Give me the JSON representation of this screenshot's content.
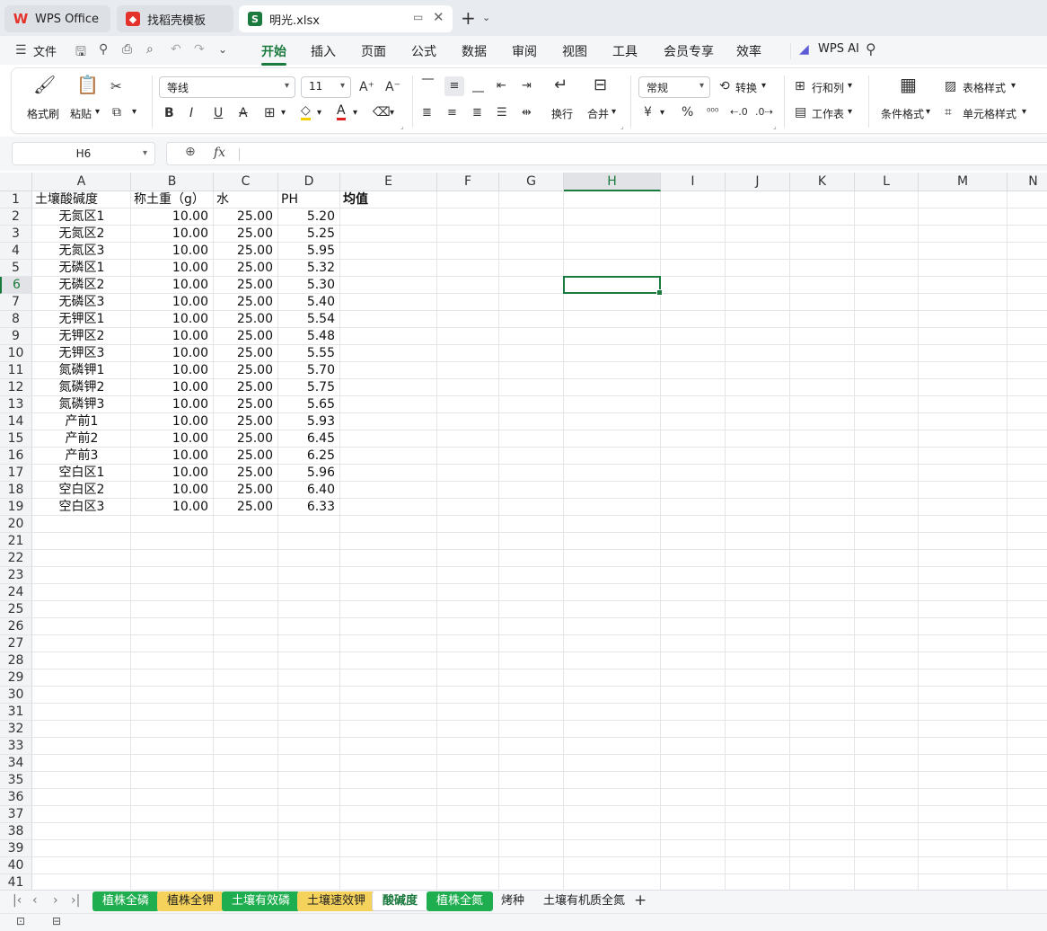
{
  "tabs": [
    {
      "label": "WPS Office",
      "icon": "wps-logo-icon",
      "color": "#e4322b"
    },
    {
      "label": "找稻壳模板",
      "icon": "docer-icon",
      "color": "#e4322b"
    },
    {
      "label": "明光.xlsx",
      "icon": "spreadsheet-icon",
      "color": "#1b7a3e"
    }
  ],
  "menu": {
    "file": "文件",
    "items": [
      "开始",
      "插入",
      "页面",
      "公式",
      "数据",
      "审阅",
      "视图",
      "工具",
      "会员专享",
      "效率"
    ],
    "active": "开始",
    "wps_ai": "WPS AI"
  },
  "ribbon": {
    "format_painter": "格式刷",
    "paste": "粘贴",
    "font_name": "等线",
    "font_size": "11",
    "wrap": "换行",
    "merge": "合并",
    "number_format": "常规",
    "convert": "转换",
    "row_col": "行和列",
    "worksheet": "工作表",
    "cond_format": "条件格式",
    "table_style": "表格样式",
    "cell_style": "单元格样式",
    "currency": "¥",
    "percent": "%"
  },
  "formula_bar": {
    "name_box": "H6",
    "fx": "fx",
    "formula": ""
  },
  "columns": [
    "A",
    "B",
    "C",
    "D",
    "E",
    "F",
    "G",
    "H",
    "I",
    "J",
    "K",
    "L",
    "M",
    "N"
  ],
  "selected_column": "H",
  "selected_row": 6,
  "rows_count": 41,
  "header_row": [
    "土壤酸碱度",
    "称土重（g）",
    "水",
    "PH",
    "均值"
  ],
  "data_rows": [
    [
      "无氮区1",
      "10.00",
      "25.00",
      "5.20"
    ],
    [
      "无氮区2",
      "10.00",
      "25.00",
      "5.25"
    ],
    [
      "无氮区3",
      "10.00",
      "25.00",
      "5.95"
    ],
    [
      "无磷区1",
      "10.00",
      "25.00",
      "5.32"
    ],
    [
      "无磷区2",
      "10.00",
      "25.00",
      "5.30"
    ],
    [
      "无磷区3",
      "10.00",
      "25.00",
      "5.40"
    ],
    [
      "无钾区1",
      "10.00",
      "25.00",
      "5.54"
    ],
    [
      "无钾区2",
      "10.00",
      "25.00",
      "5.48"
    ],
    [
      "无钾区3",
      "10.00",
      "25.00",
      "5.55"
    ],
    [
      "氮磷钾1",
      "10.00",
      "25.00",
      "5.70"
    ],
    [
      "氮磷钾2",
      "10.00",
      "25.00",
      "5.75"
    ],
    [
      "氮磷钾3",
      "10.00",
      "25.00",
      "5.65"
    ],
    [
      "产前1",
      "10.00",
      "25.00",
      "5.93"
    ],
    [
      "产前2",
      "10.00",
      "25.00",
      "6.45"
    ],
    [
      "产前3",
      "10.00",
      "25.00",
      "6.25"
    ],
    [
      "空白区1",
      "10.00",
      "25.00",
      "5.96"
    ],
    [
      "空白区2",
      "10.00",
      "25.00",
      "6.40"
    ],
    [
      "空白区3",
      "10.00",
      "25.00",
      "6.33"
    ]
  ],
  "sheets": [
    {
      "name": "植株全磷",
      "color": "#1fae4f",
      "text": "#ffffff"
    },
    {
      "name": "植株全钾",
      "color": "#f5d25c",
      "text": "#222222"
    },
    {
      "name": "土壤有效磷",
      "color": "#1fae4f",
      "text": "#ffffff"
    },
    {
      "name": "土壤速效钾",
      "color": "#f5d25c",
      "text": "#222222"
    },
    {
      "name": "酸碱度",
      "color": "#ffffff",
      "text": "#1b7a3e",
      "active": true
    },
    {
      "name": "植株全氮",
      "color": "#1fae4f",
      "text": "#ffffff"
    },
    {
      "name": "烤种",
      "color": "",
      "text": "#222222"
    },
    {
      "name": "土壤有机质全氮",
      "color": "",
      "text": "#222222"
    }
  ],
  "add_sheet": "+",
  "accent": "#1b7a3e"
}
